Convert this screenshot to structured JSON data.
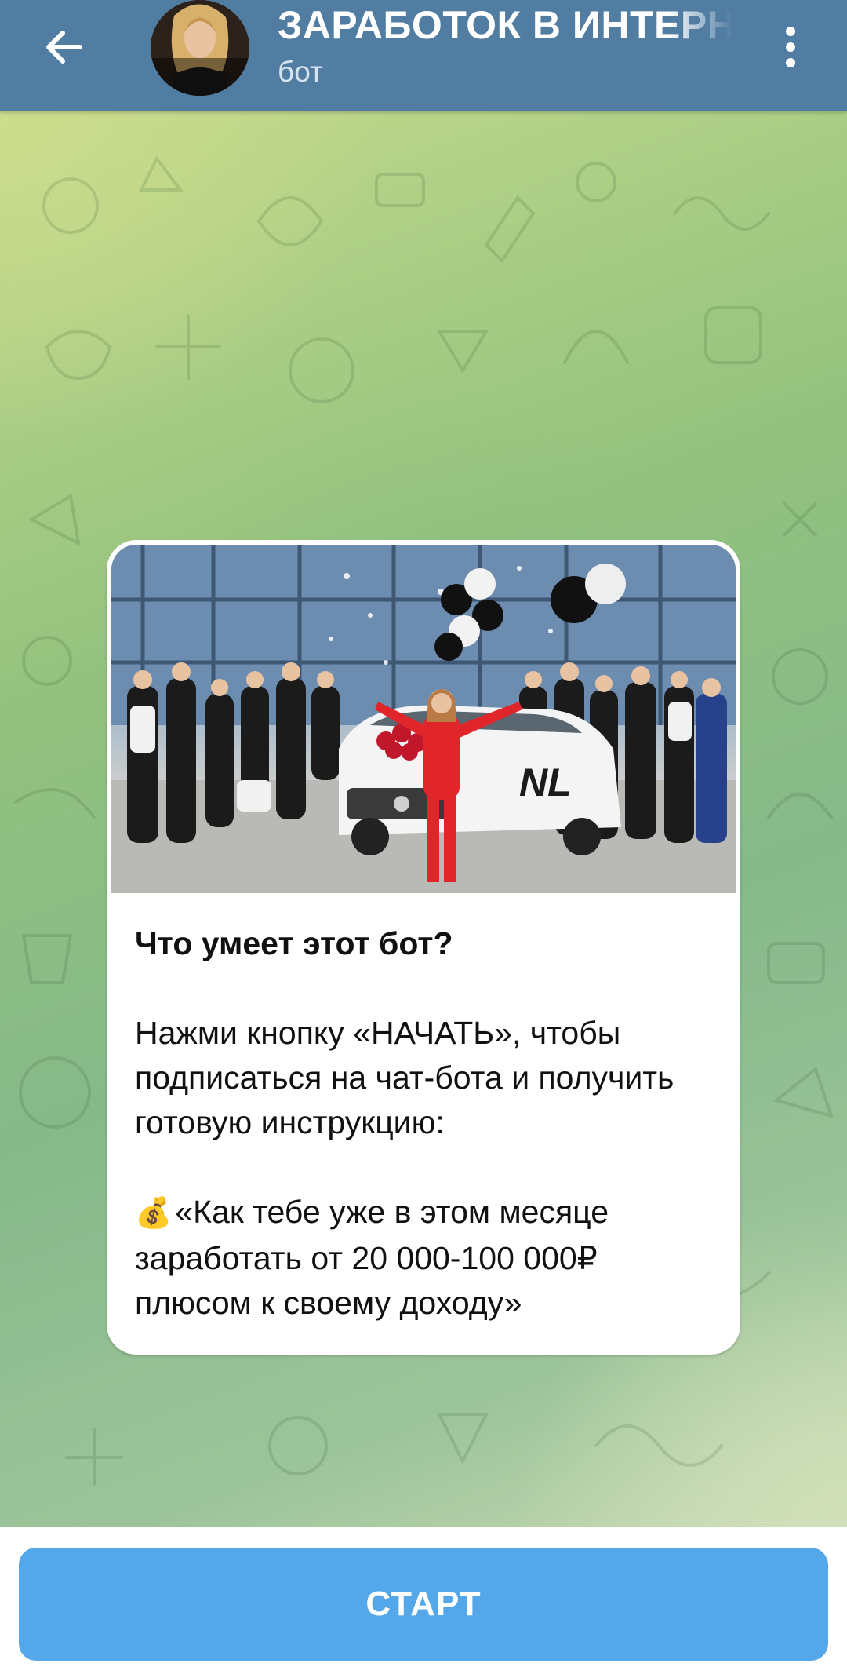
{
  "header": {
    "back_icon": "arrow-left-icon",
    "title": "ЗАРАБОТОК В ИНТЕРН",
    "subtitle": "бот",
    "menu_icon": "more-vertical-icon",
    "color": "#527da3"
  },
  "message": {
    "heading": "Что умеет этот бот?",
    "paragraph1": "Нажми кнопку «НАЧАТЬ», чтобы подписаться на чат-бота и получить готовую инструкцию:",
    "money_icon": "💰",
    "paragraph2": "«Как тебе уже в этом месяце заработать от 20 000-100 000₽ плюсом к своему доходу»"
  },
  "bottom": {
    "start_label": "СТАРТ",
    "button_color": "#54a7e8"
  }
}
